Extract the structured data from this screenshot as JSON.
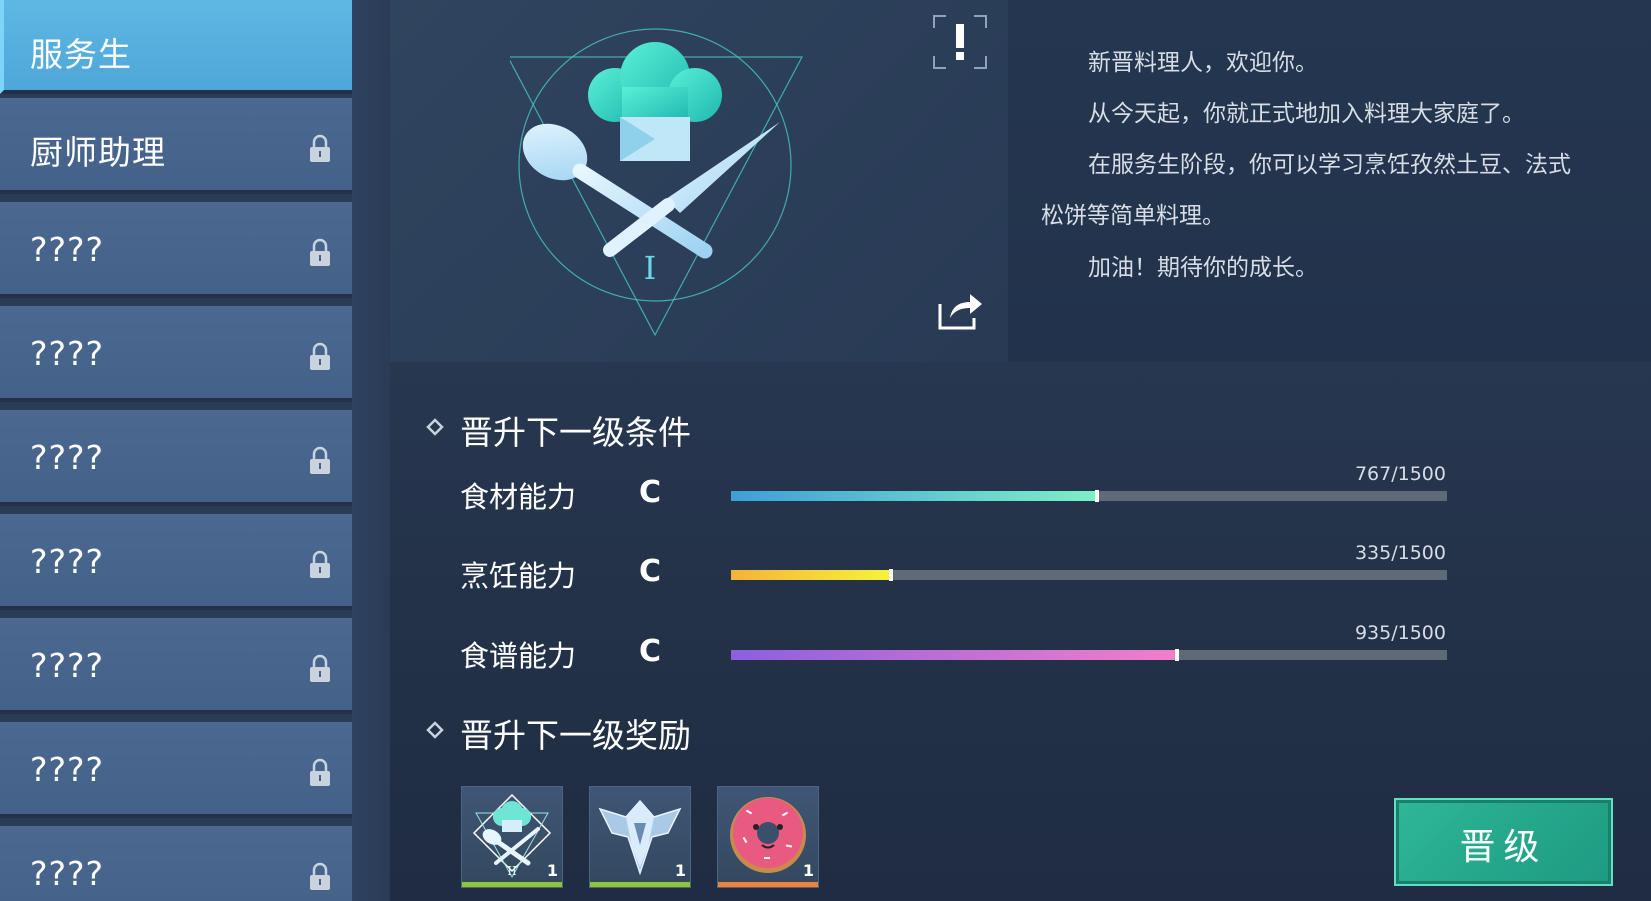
{
  "sidebar": {
    "items": [
      {
        "label": "服务生",
        "locked": false,
        "active": true
      },
      {
        "label": "厨师助理",
        "locked": true,
        "active": false
      },
      {
        "label": "????",
        "locked": true,
        "active": false
      },
      {
        "label": "????",
        "locked": true,
        "active": false
      },
      {
        "label": "????",
        "locked": true,
        "active": false
      },
      {
        "label": "????",
        "locked": true,
        "active": false
      },
      {
        "label": "????",
        "locked": true,
        "active": false
      },
      {
        "label": "????",
        "locked": true,
        "active": false
      },
      {
        "label": "????",
        "locked": true,
        "active": false
      }
    ]
  },
  "badge": {
    "rank_numeral": "I",
    "icons": [
      "chef-hat-icon",
      "spoon-icon",
      "knife-icon"
    ]
  },
  "description": {
    "lines": [
      "新晋料理人，欢迎你。",
      "从今天起，你就正式地加入料理大家庭了。",
      "在服务生阶段，你可以学习烹饪孜然土豆、法式",
      "松饼等简单料理。",
      "加油！期待你的成长。"
    ]
  },
  "conditions": {
    "title": "晋升下一级条件",
    "stats": [
      {
        "name": "食材能力",
        "grade": "C",
        "current": 767,
        "max": 1500,
        "value_text": "767/1500",
        "colors": [
          "#3f9fd6",
          "#7cf0c7"
        ]
      },
      {
        "name": "烹饪能力",
        "grade": "C",
        "current": 335,
        "max": 1500,
        "value_text": "335/1500",
        "colors": [
          "#f5b23a",
          "#f7f33a"
        ]
      },
      {
        "name": "食谱能力",
        "grade": "C",
        "current": 935,
        "max": 1500,
        "value_text": "935/1500",
        "colors": [
          "#8d5fe0",
          "#f27fc8"
        ]
      }
    ]
  },
  "rewards": {
    "title": "晋升下一级奖励",
    "items": [
      {
        "icon": "chef-badge-icon",
        "count": "1",
        "rarity_color": "#8fc43a"
      },
      {
        "icon": "crystal-emblem-icon",
        "count": "1",
        "rarity_color": "#8fc43a"
      },
      {
        "icon": "donut-icon",
        "count": "1",
        "rarity_color": "#f0823a"
      }
    ]
  },
  "promote_button": {
    "label": "晋级"
  },
  "colors": {
    "accent": "#4ea7d9",
    "button": "#26a98d"
  }
}
